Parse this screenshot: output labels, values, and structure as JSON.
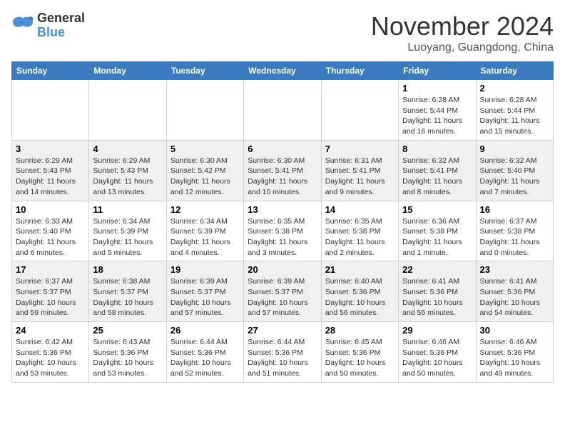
{
  "logo": {
    "line1": "General",
    "line2": "Blue"
  },
  "title": "November 2024",
  "location": "Luoyang, Guangdong, China",
  "weekdays": [
    "Sunday",
    "Monday",
    "Tuesday",
    "Wednesday",
    "Thursday",
    "Friday",
    "Saturday"
  ],
  "weeks": [
    [
      {
        "day": "",
        "info": ""
      },
      {
        "day": "",
        "info": ""
      },
      {
        "day": "",
        "info": ""
      },
      {
        "day": "",
        "info": ""
      },
      {
        "day": "",
        "info": ""
      },
      {
        "day": "1",
        "info": "Sunrise: 6:28 AM\nSunset: 5:44 PM\nDaylight: 11 hours\nand 16 minutes."
      },
      {
        "day": "2",
        "info": "Sunrise: 6:28 AM\nSunset: 5:44 PM\nDaylight: 11 hours\nand 15 minutes."
      }
    ],
    [
      {
        "day": "3",
        "info": "Sunrise: 6:29 AM\nSunset: 5:43 PM\nDaylight: 11 hours\nand 14 minutes."
      },
      {
        "day": "4",
        "info": "Sunrise: 6:29 AM\nSunset: 5:43 PM\nDaylight: 11 hours\nand 13 minutes."
      },
      {
        "day": "5",
        "info": "Sunrise: 6:30 AM\nSunset: 5:42 PM\nDaylight: 11 hours\nand 12 minutes."
      },
      {
        "day": "6",
        "info": "Sunrise: 6:30 AM\nSunset: 5:41 PM\nDaylight: 11 hours\nand 10 minutes."
      },
      {
        "day": "7",
        "info": "Sunrise: 6:31 AM\nSunset: 5:41 PM\nDaylight: 11 hours\nand 9 minutes."
      },
      {
        "day": "8",
        "info": "Sunrise: 6:32 AM\nSunset: 5:41 PM\nDaylight: 11 hours\nand 8 minutes."
      },
      {
        "day": "9",
        "info": "Sunrise: 6:32 AM\nSunset: 5:40 PM\nDaylight: 11 hours\nand 7 minutes."
      }
    ],
    [
      {
        "day": "10",
        "info": "Sunrise: 6:33 AM\nSunset: 5:40 PM\nDaylight: 11 hours\nand 6 minutes."
      },
      {
        "day": "11",
        "info": "Sunrise: 6:34 AM\nSunset: 5:39 PM\nDaylight: 11 hours\nand 5 minutes."
      },
      {
        "day": "12",
        "info": "Sunrise: 6:34 AM\nSunset: 5:39 PM\nDaylight: 11 hours\nand 4 minutes."
      },
      {
        "day": "13",
        "info": "Sunrise: 6:35 AM\nSunset: 5:38 PM\nDaylight: 11 hours\nand 3 minutes."
      },
      {
        "day": "14",
        "info": "Sunrise: 6:35 AM\nSunset: 5:38 PM\nDaylight: 11 hours\nand 2 minutes."
      },
      {
        "day": "15",
        "info": "Sunrise: 6:36 AM\nSunset: 5:38 PM\nDaylight: 11 hours\nand 1 minute."
      },
      {
        "day": "16",
        "info": "Sunrise: 6:37 AM\nSunset: 5:38 PM\nDaylight: 11 hours\nand 0 minutes."
      }
    ],
    [
      {
        "day": "17",
        "info": "Sunrise: 6:37 AM\nSunset: 5:37 PM\nDaylight: 10 hours\nand 59 minutes."
      },
      {
        "day": "18",
        "info": "Sunrise: 6:38 AM\nSunset: 5:37 PM\nDaylight: 10 hours\nand 58 minutes."
      },
      {
        "day": "19",
        "info": "Sunrise: 6:39 AM\nSunset: 5:37 PM\nDaylight: 10 hours\nand 57 minutes."
      },
      {
        "day": "20",
        "info": "Sunrise: 6:39 AM\nSunset: 5:37 PM\nDaylight: 10 hours\nand 57 minutes."
      },
      {
        "day": "21",
        "info": "Sunrise: 6:40 AM\nSunset: 5:36 PM\nDaylight: 10 hours\nand 56 minutes."
      },
      {
        "day": "22",
        "info": "Sunrise: 6:41 AM\nSunset: 5:36 PM\nDaylight: 10 hours\nand 55 minutes."
      },
      {
        "day": "23",
        "info": "Sunrise: 6:41 AM\nSunset: 5:36 PM\nDaylight: 10 hours\nand 54 minutes."
      }
    ],
    [
      {
        "day": "24",
        "info": "Sunrise: 6:42 AM\nSunset: 5:36 PM\nDaylight: 10 hours\nand 53 minutes."
      },
      {
        "day": "25",
        "info": "Sunrise: 6:43 AM\nSunset: 5:36 PM\nDaylight: 10 hours\nand 53 minutes."
      },
      {
        "day": "26",
        "info": "Sunrise: 6:44 AM\nSunset: 5:36 PM\nDaylight: 10 hours\nand 52 minutes."
      },
      {
        "day": "27",
        "info": "Sunrise: 6:44 AM\nSunset: 5:36 PM\nDaylight: 10 hours\nand 51 minutes."
      },
      {
        "day": "28",
        "info": "Sunrise: 6:45 AM\nSunset: 5:36 PM\nDaylight: 10 hours\nand 50 minutes."
      },
      {
        "day": "29",
        "info": "Sunrise: 6:46 AM\nSunset: 5:36 PM\nDaylight: 10 hours\nand 50 minutes."
      },
      {
        "day": "30",
        "info": "Sunrise: 6:46 AM\nSunset: 5:36 PM\nDaylight: 10 hours\nand 49 minutes."
      }
    ]
  ]
}
